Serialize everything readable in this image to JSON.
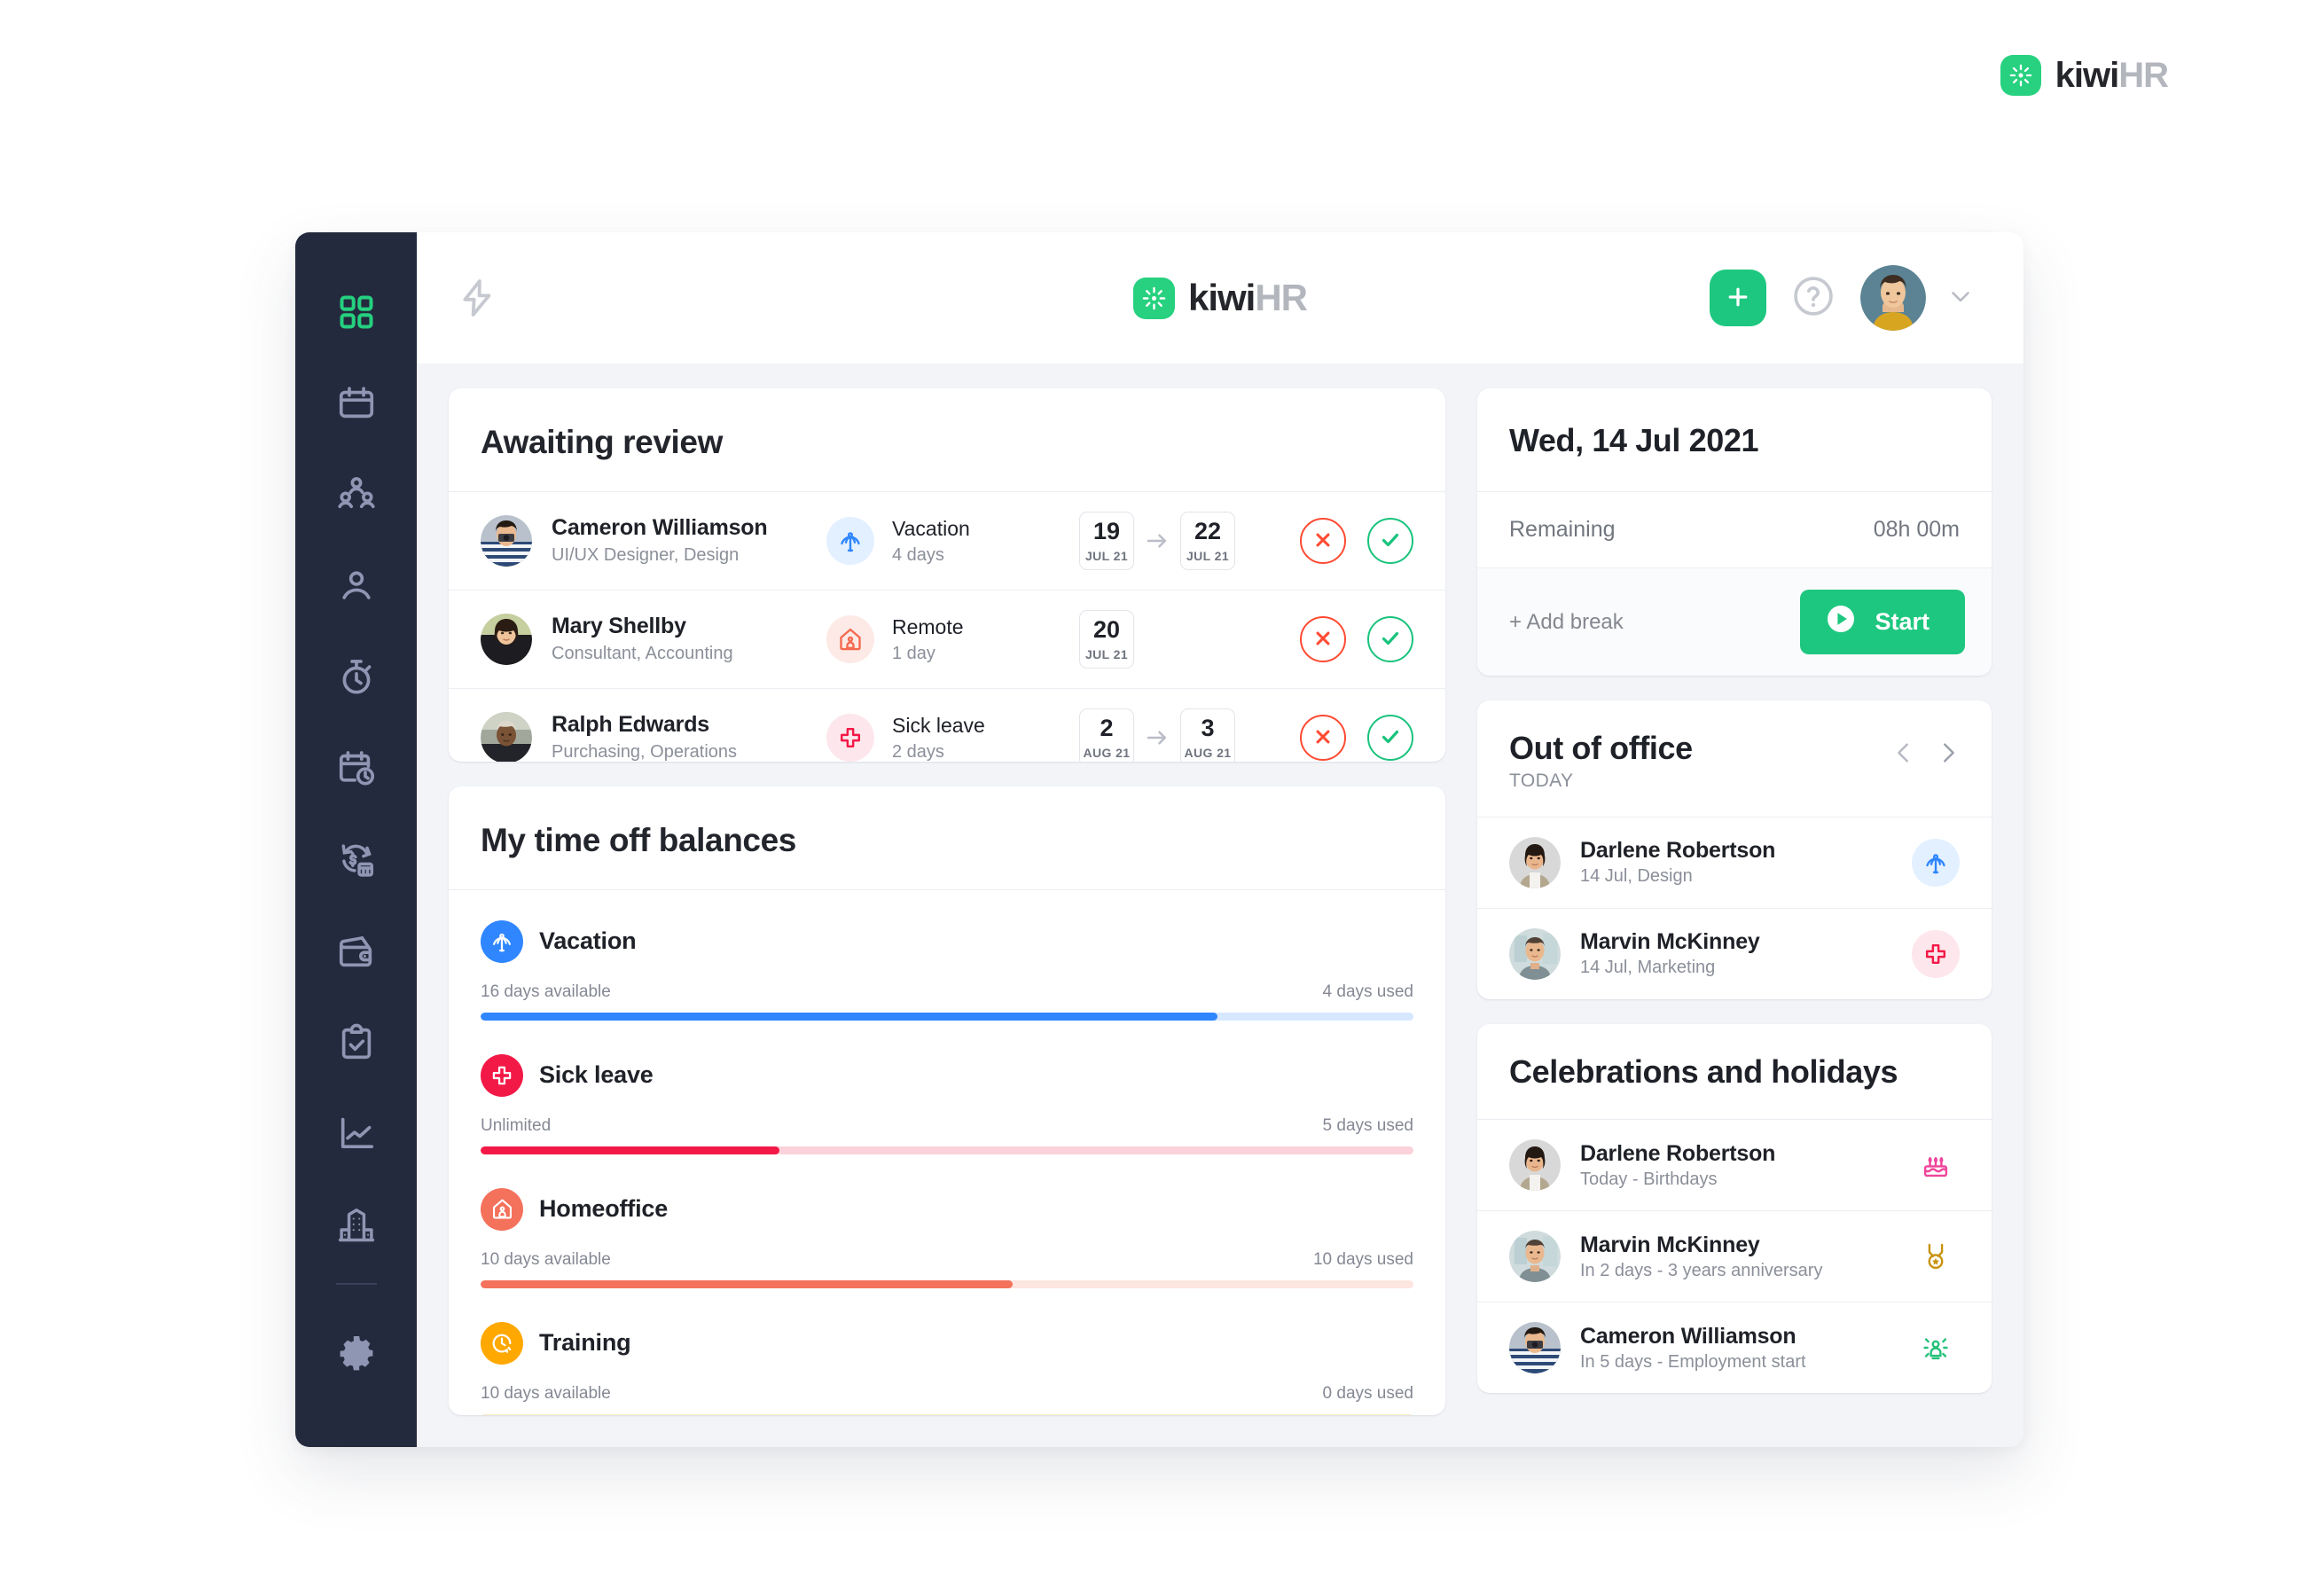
{
  "brand": {
    "name_primary": "kiwi",
    "name_secondary": "HR",
    "logo_icon": "kiwi-sunburst-icon",
    "accent": "#27d17f"
  },
  "header": {
    "bolt_icon": "lightning-bolt-icon",
    "add_icon": "plus-icon",
    "help_icon": "question-circle-icon",
    "avatar_icon": "user-avatar",
    "chevron_icon": "chevron-down-icon"
  },
  "sidebar": {
    "items": [
      {
        "icon": "dashboard-grid-icon",
        "name": "dashboard",
        "active": true
      },
      {
        "icon": "calendar-icon",
        "name": "calendar",
        "active": false
      },
      {
        "icon": "team-people-icon",
        "name": "team",
        "active": false
      },
      {
        "icon": "person-icon",
        "name": "employees",
        "active": false
      },
      {
        "icon": "stopwatch-icon",
        "name": "time-tracking",
        "active": false
      },
      {
        "icon": "calendar-clock-icon",
        "name": "absences",
        "active": false
      },
      {
        "icon": "payroll-exchange-icon",
        "name": "payroll",
        "active": false
      },
      {
        "icon": "wallet-icon",
        "name": "expenses",
        "active": false
      },
      {
        "icon": "clipboard-check-icon",
        "name": "tasks",
        "active": false
      },
      {
        "icon": "chart-line-icon",
        "name": "reports",
        "active": false
      },
      {
        "icon": "building-icon",
        "name": "company",
        "active": false
      },
      {
        "icon": "gear-icon",
        "name": "settings",
        "active": false
      }
    ]
  },
  "awaiting_review": {
    "title": "Awaiting review",
    "reject_icon": "x-circle-icon",
    "approve_icon": "check-circle-icon",
    "arrow_icon": "arrow-right-icon",
    "rows": [
      {
        "name": "Cameron Williamson",
        "role": "UI/UX Designer, Design",
        "type": "Vacation",
        "type_icon": "palm-tree-icon",
        "type_color": "#2f86ff",
        "type_bg": "#e3f0ff",
        "duration": "4 days",
        "date_from_day": "19",
        "date_from_month": "JUL 21",
        "date_to_day": "22",
        "date_to_month": "JUL 21",
        "has_range": true
      },
      {
        "name": "Mary Shellby",
        "role": "Consultant, Accounting",
        "type": "Remote",
        "type_icon": "home-icon",
        "type_color": "#f4694f",
        "type_bg": "#fdeae6",
        "duration": "1 day",
        "date_from_day": "20",
        "date_from_month": "JUL 21",
        "date_to_day": "",
        "date_to_month": "",
        "has_range": false
      },
      {
        "name": "Ralph Edwards",
        "role": "Purchasing, Operations",
        "type": "Sick leave",
        "type_icon": "medical-cross-icon",
        "type_color": "#f31947",
        "type_bg": "#fde7ec",
        "duration": "2 days",
        "date_from_day": "2",
        "date_from_month": "AUG 21",
        "date_to_day": "3",
        "date_to_month": "AUG 21",
        "has_range": true
      }
    ]
  },
  "balances": {
    "title": "My time off balances",
    "items": [
      {
        "name": "Vacation",
        "icon": "palm-tree-icon",
        "icon_bg": "#2f86ff",
        "available": "16 days available",
        "used": "4 days used",
        "fill_percent": 79,
        "bar_color": "#2f86ff",
        "track_color": "#d7e7ff"
      },
      {
        "name": "Sick leave",
        "icon": "medical-cross-icon",
        "icon_bg": "#f31947",
        "available": "Unlimited",
        "used": "5 days used",
        "fill_percent": 32,
        "bar_color": "#f31947",
        "track_color": "#fbd2da"
      },
      {
        "name": "Homeoffice",
        "icon": "home-icon",
        "icon_bg": "#f4715b",
        "available": "10 days available",
        "used": "10 days used",
        "fill_percent": 57,
        "bar_color": "#f4715b",
        "track_color": "#fde5e0"
      },
      {
        "name": "Training",
        "icon": "training-clock-icon",
        "icon_bg": "#ffa800",
        "available": "10 days available",
        "used": "0 days used",
        "fill_percent": 0,
        "bar_color": "#ffa800",
        "track_color": "#fdeac4"
      }
    ]
  },
  "today": {
    "date": "Wed, 14 Jul 2021",
    "remaining_label": "Remaining",
    "remaining_value": "08h 00m",
    "add_break_label": "+ Add break",
    "start_label": "Start",
    "start_icon": "play-circle-icon"
  },
  "out_of_office": {
    "title": "Out of office",
    "subtitle": "TODAY",
    "prev_icon": "chevron-left-icon",
    "next_icon": "chevron-right-icon",
    "rows": [
      {
        "name": "Darlene Robertson",
        "sub": "14 Jul, Design",
        "icon": "palm-tree-icon",
        "icon_color": "#2f86ff",
        "icon_bg": "#e3f0ff"
      },
      {
        "name": "Marvin McKinney",
        "sub": "14 Jul, Marketing",
        "icon": "medical-cross-icon",
        "icon_color": "#f31947",
        "icon_bg": "#fde7ec"
      }
    ]
  },
  "celebrations": {
    "title": "Celebrations and holidays",
    "rows": [
      {
        "name": "Darlene Robertson",
        "sub": "Today - Birthdays",
        "icon": "birthday-cake-icon",
        "icon_color": "#f0459a"
      },
      {
        "name": "Marvin McKinney",
        "sub": "In 2 days - 3 years anniversary",
        "icon": "medal-icon",
        "icon_color": "#c89310"
      },
      {
        "name": "Cameron Williamson",
        "sub": "In 5 days - Employment start",
        "icon": "new-hire-spark-icon",
        "icon_color": "#24c17a"
      }
    ]
  }
}
